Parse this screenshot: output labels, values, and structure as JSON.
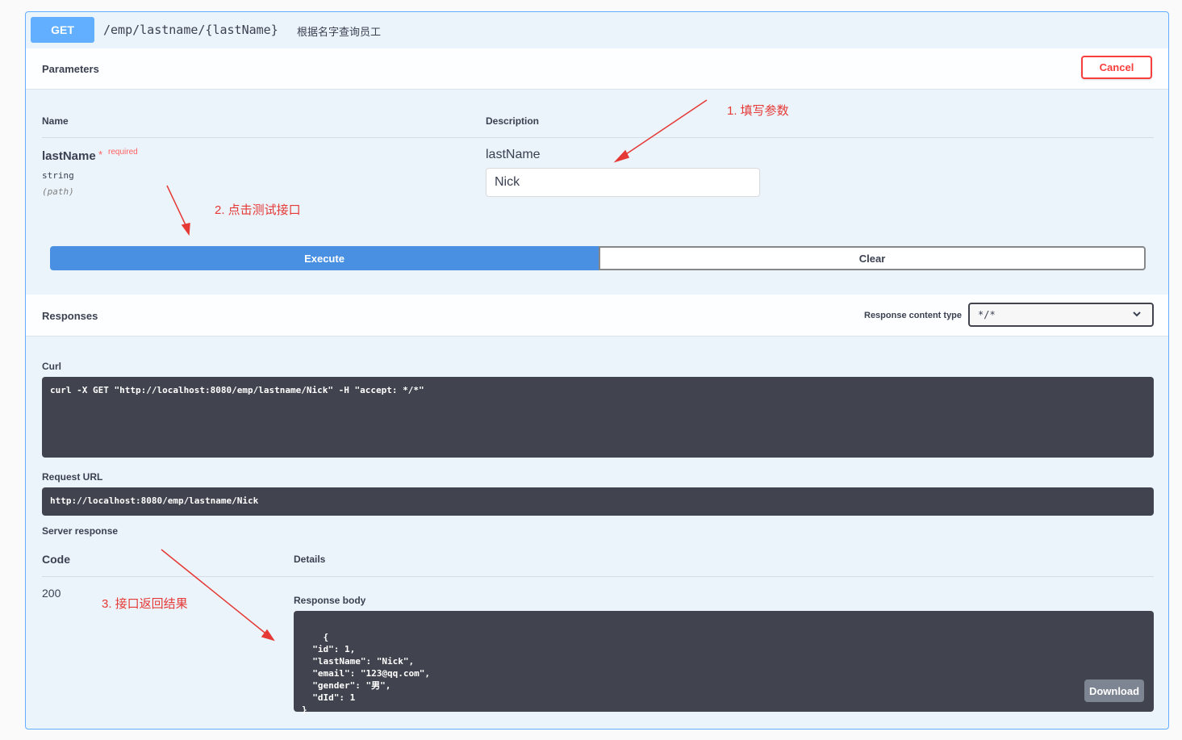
{
  "endpoint": {
    "method": "GET",
    "path": "/emp/lastname/{lastName}",
    "summary": "根据名字查询员工"
  },
  "parameters": {
    "title": "Parameters",
    "cancel_label": "Cancel",
    "col_name": "Name",
    "col_description": "Description",
    "param": {
      "name": "lastName",
      "required_star": "*",
      "required_label": "required",
      "type": "string",
      "in": "(path)",
      "description": "lastName",
      "value": "Nick"
    },
    "execute_label": "Execute",
    "clear_label": "Clear"
  },
  "responses": {
    "title": "Responses",
    "content_type_label": "Response content type",
    "content_type_value": "*/*",
    "curl_label": "Curl",
    "curl_value": "curl -X GET \"http://localhost:8080/emp/lastname/Nick\" -H \"accept: */*\"",
    "request_url_label": "Request URL",
    "request_url_value": "http://localhost:8080/emp/lastname/Nick",
    "server_response_label": "Server response",
    "code_header": "Code",
    "details_header": "Details",
    "code_value": "200",
    "response_body_label": "Response body",
    "response_body": "{\n  \"id\": 1,\n  \"lastName\": \"Nick\",\n  \"email\": \"123@qq.com\",\n  \"gender\": \"男\",\n  \"dId\": 1\n}",
    "download_label": "Download"
  },
  "annotations": {
    "step1": "1. 填写参数",
    "step2": "2. 点击测试接口",
    "step3": "3. 接口返回结果"
  },
  "colors": {
    "get_method": "#61affe",
    "execute": "#4990e2",
    "cancel": "#f93e3e",
    "code_bg": "#41444e",
    "annotation": "#e53935"
  }
}
